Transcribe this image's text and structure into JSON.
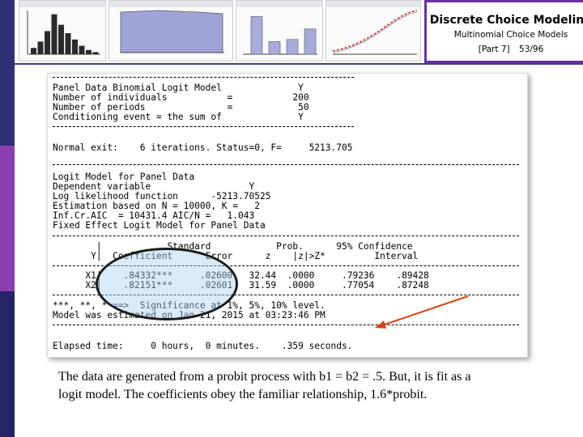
{
  "header": {
    "title": "Discrete Choice Modeling",
    "subtitle": "Multinomial Choice Models",
    "part_label": "[Part 7]",
    "page": "53/96",
    "accent": "#6c2f9e",
    "stripe_colors": [
      "#2f2f73",
      "#8a3fb0",
      "#252566"
    ]
  },
  "thumbnails": [
    {
      "kind": "histogram",
      "bars": [
        0.15,
        0.3,
        0.55,
        0.95,
        0.7,
        0.5,
        0.35,
        0.2,
        0.1,
        0.05
      ]
    },
    {
      "kind": "filled-area"
    },
    {
      "kind": "bar",
      "bars": [
        0.9,
        0.3,
        0.35,
        0.6
      ]
    },
    {
      "kind": "curve"
    }
  ],
  "output": {
    "block1": [
      "Panel Data Binomial Logit Model              Y",
      "Number of individuals           =           200",
      "Number of periods               =            50",
      "Conditioning event = the sum of              Y"
    ],
    "status_line": "Normal exit:    6 iterations. Status=0, F=     5213.705",
    "block2": [
      "Logit Model for Panel Data",
      "Dependent variable                  Y",
      "Log likelihood function      -5213.70525",
      "Estimation based on N = 10000, K =   2",
      "Inf.Cr.AIC  = 10431.4 AIC/N =   1.043",
      "Fixed Effect Logit Model for Panel Data"
    ],
    "table_header1": "        |            Standard            Prob.      95% Confidence",
    "table_header2": "       Y|  Coefficient      Error      z    |z|>Z*         Interval",
    "rows": [
      "      X1|    .84332***     .02600   32.44  .0000     .79236    .89428",
      "      X2|    .82151***     .02601   31.59  .0000     .77054    .87248"
    ],
    "significance": "***, **, * ==>  Significance at 1%, 5%, 10% level.",
    "estimated": "Model was estimated on Jan 21, 2015 at 03:23:46 PM",
    "elapsed": "Elapsed time:     0 hours,  0 minutes.    .359 seconds."
  },
  "caption": {
    "line1": "The data are generated from a probit process with b1 = b2 = .5. But, it is fit as a",
    "line2": "logit model.  The coefficients obey the familiar relationship, 1.6*probit."
  }
}
